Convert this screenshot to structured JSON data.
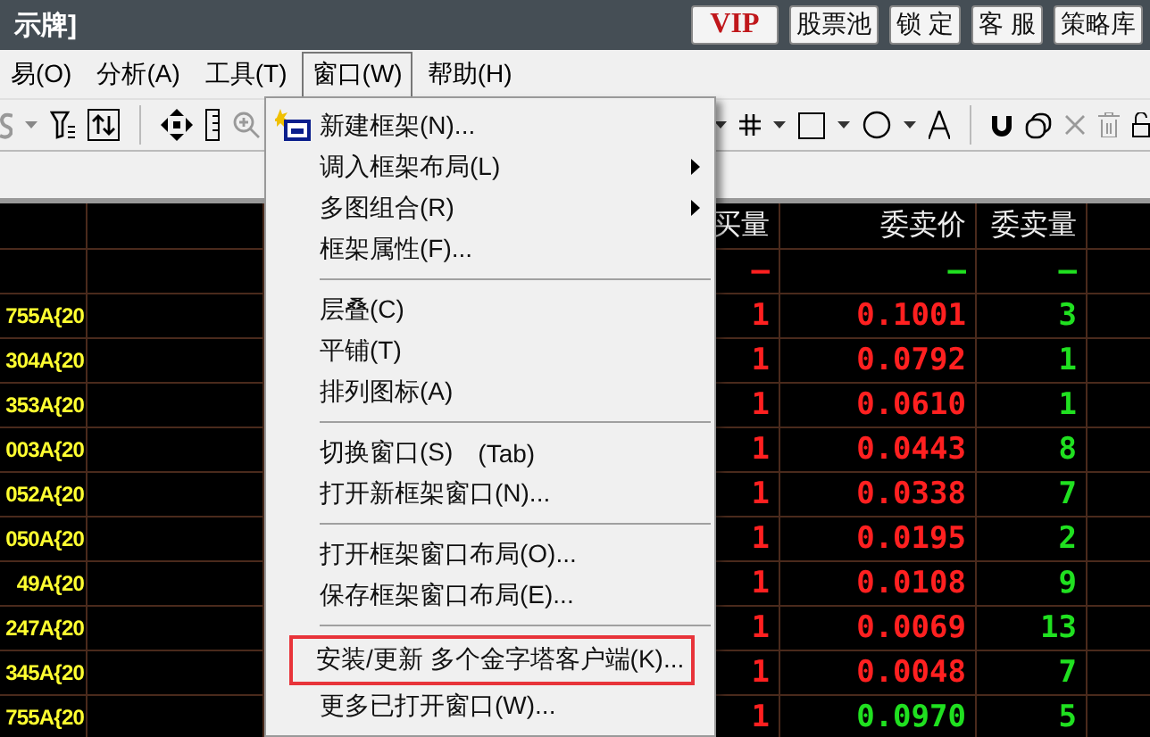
{
  "title_bar": {
    "title": "示牌]",
    "buttons": [
      {
        "label": "VIP",
        "kind": "vip"
      },
      {
        "label": "股票池",
        "kind": "plain"
      },
      {
        "label": "锁 定",
        "kind": "plain"
      },
      {
        "label": "客 服",
        "kind": "plain"
      },
      {
        "label": "策略库",
        "kind": "plain"
      }
    ]
  },
  "menu_bar": [
    {
      "label": "易(O)",
      "selected": false
    },
    {
      "label": "分析(A)",
      "selected": false
    },
    {
      "label": "工具(T)",
      "selected": false
    },
    {
      "label": "窗口(W)",
      "selected": true
    },
    {
      "label": "帮助(H)",
      "selected": false
    }
  ],
  "window_menu": [
    {
      "kind": "item",
      "label": "新建框架(N)...",
      "icon": true
    },
    {
      "kind": "item",
      "label": "调入框架布局(L)",
      "submenu": true
    },
    {
      "kind": "item",
      "label": "多图组合(R)",
      "submenu": true
    },
    {
      "kind": "item",
      "label": "框架属性(F)..."
    },
    {
      "kind": "separator"
    },
    {
      "kind": "item",
      "label": "层叠(C)"
    },
    {
      "kind": "item",
      "label": "平铺(T)"
    },
    {
      "kind": "item",
      "label": "排列图标(A)"
    },
    {
      "kind": "separator"
    },
    {
      "kind": "item",
      "label": "切换窗口(S)",
      "shortcut": "(Tab)"
    },
    {
      "kind": "item",
      "label": "打开新框架窗口(N)..."
    },
    {
      "kind": "separator"
    },
    {
      "kind": "item",
      "label": "打开框架窗口布局(O)..."
    },
    {
      "kind": "item",
      "label": "保存框架窗口布局(E)..."
    },
    {
      "kind": "separator"
    },
    {
      "kind": "item",
      "label": "安装/更新 多个金字塔客户端(K)...",
      "outlined": true
    },
    {
      "kind": "item",
      "label": "更多已打开窗口(W)..."
    }
  ],
  "table": {
    "headers": [
      "买量",
      "委卖价",
      "委卖量"
    ],
    "rows": [
      {
        "cells": [
          {
            "text": "—",
            "color": "#ff2020"
          },
          {
            "text": "—",
            "color": "#20e020"
          },
          {
            "text": "—",
            "color": "#20e020"
          }
        ]
      },
      {
        "code": "755A{20",
        "cells": [
          {
            "text": "1",
            "color": "#ff2020"
          },
          {
            "text": "0.1001",
            "color": "#ff2020"
          },
          {
            "text": "3",
            "color": "#20e020"
          }
        ]
      },
      {
        "code": "304A{20",
        "cells": [
          {
            "text": "1",
            "color": "#ff2020"
          },
          {
            "text": "0.0792",
            "color": "#ff2020"
          },
          {
            "text": "1",
            "color": "#20e020"
          }
        ]
      },
      {
        "code": "353A{20",
        "cells": [
          {
            "text": "1",
            "color": "#ff2020"
          },
          {
            "text": "0.0610",
            "color": "#ff2020"
          },
          {
            "text": "1",
            "color": "#20e020"
          }
        ]
      },
      {
        "code": "003A{20",
        "cells": [
          {
            "text": "1",
            "color": "#ff2020"
          },
          {
            "text": "0.0443",
            "color": "#ff2020"
          },
          {
            "text": "8",
            "color": "#20e020"
          }
        ]
      },
      {
        "code": "052A{20",
        "cells": [
          {
            "text": "1",
            "color": "#ff2020"
          },
          {
            "text": "0.0338",
            "color": "#ff2020"
          },
          {
            "text": "7",
            "color": "#20e020"
          }
        ]
      },
      {
        "code": "050A{20",
        "cells": [
          {
            "text": "1",
            "color": "#ff2020"
          },
          {
            "text": "0.0195",
            "color": "#ff2020"
          },
          {
            "text": "2",
            "color": "#20e020"
          }
        ]
      },
      {
        "code": "49A{20",
        "cells": [
          {
            "text": "1",
            "color": "#ff2020"
          },
          {
            "text": "0.0108",
            "color": "#ff2020"
          },
          {
            "text": "9",
            "color": "#20e020"
          }
        ]
      },
      {
        "code": "247A{20",
        "cells": [
          {
            "text": "1",
            "color": "#ff2020"
          },
          {
            "text": "0.0069",
            "color": "#ff2020"
          },
          {
            "text": "13",
            "color": "#20e020"
          }
        ]
      },
      {
        "code": "345A{20",
        "cells": [
          {
            "text": "1",
            "color": "#ff2020"
          },
          {
            "text": "0.0048",
            "color": "#ff2020"
          },
          {
            "text": "7",
            "color": "#20e020"
          }
        ]
      },
      {
        "code": "755A{20",
        "cells": [
          {
            "text": "1",
            "color": "#ff2020"
          },
          {
            "text": "0.0970",
            "color": "#20e020"
          },
          {
            "text": "5",
            "color": "#20e020"
          }
        ]
      }
    ]
  }
}
